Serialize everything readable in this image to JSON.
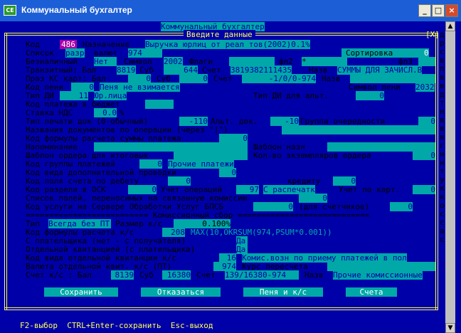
{
  "window": {
    "title": "Коммунальный бухгалтер",
    "icon_text": "CE",
    "min": "_",
    "max": "□",
    "close": "×"
  },
  "console": {
    "header": "Коммунальный бухгалтер",
    "dialog_title": "Введите данные",
    "close_marker": "[X]",
    "right": [
      "д",
      "р",
      "с",
      "в",
      "п",
      "в",
      "в",
      "д",
      "т",
      "н",
      "в",
      "в",
      "в",
      "г",
      "н",
      "н",
      "т",
      "у",
      "к",
      "к",
      "о",
      "с",
      "с",
      "а",
      "с"
    ]
  },
  "f": {
    "kod_l": "Код",
    "kod_v": "486",
    "nazn_l": "Назначение",
    "nazn_v": "Выручка юрлиц от реал тов(2002)0.1%",
    "spisok_l": "Список",
    "spisok_v": "разр",
    "valyut_l": "валют",
    "valyut_v": "974",
    "sort_l": "Сортировка",
    "sort_v": "0",
    "bezn_l": "Безналичный",
    "bezn_v": "Нет",
    "simv_l": "Символ",
    "simv_v": "2002",
    "flagi_l": "Флаги",
    "fl2_l": "фл2",
    "fl2_v": "*",
    "fl3_l": "фл3",
    "tranz_l": "Транзитный: Бал",
    "tranz_bal": "8819",
    "tranz_sub_l": "Суб",
    "tranz_sub": "644",
    "tranz_sch_l": "Счет",
    "tranz_sch": "3819382111435",
    "tranz_naz_l": "Назв",
    "tranz_naz": "СУММЫ ДЛЯ ЗАЧИСЛ.В",
    "ks_l": "Праз КС карт: Бал",
    "ks_bal": "0",
    "ks_sub_l": "Суб",
    "ks_sub": "0",
    "ks_sch_l": "Счет",
    "ks_sch": "-1/0/0-974",
    "ks_naz_l": "Назв",
    "peni_l": "Код пени",
    "peni_v": "0",
    "peni_t": "Пеня не взимается",
    "speni_l": "Символ пени",
    "speni_v": "2032",
    "tdi_l": "Тип ДИ",
    "tdi_v": "11",
    "tdi_t": "Юр.лица",
    "tdia_l": "Тип ДИ для альт.",
    "tdia_v": "0",
    "bud_l": "Код платежа в бюджет",
    "nds_l": "Ставка НДС",
    "nds_v": "0.0",
    "nds_p": "%",
    "tpech_l": "Тип печати док (0-обычный)",
    "tpech_v": "-110",
    "alt_l": "Альт. док.",
    "alt_v": "-10",
    "grup_l": "Группа очередности",
    "grup_v": "0",
    "ndok_l": "Названия документов по операции (через \"|\")",
    "kform_l": "Код формулы расчета суммы платежа",
    "kform_v": "0",
    "napom_l": "Напоминание",
    "shn_l": "Шаблон назн",
    "sho_l": "Шаблон ордера для итоговых",
    "kolvo_l": "Кол-во экземпляров ордера",
    "kolvo_v": "0",
    "kgr_l": "Код группы платежей",
    "kgr_v": "0",
    "kgr_t": "Прочие платежи",
    "kvid_l": "Код вида дополнительной проводки",
    "kvid_v": "0",
    "kpol_l": "Код поля счета по дебету",
    "kpol_v": "0",
    "kred_l": "кредиту",
    "kred_v": "0",
    "razd_l": "Код раздела в ОСК",
    "razd_v": "0",
    "uch_l": "Учет операций",
    "uch_v": "97",
    "uch_t": "С распечатк",
    "uchk_l": "Учет по карт.",
    "uchk_v": "0",
    "spol_l": "Список полей, переносимых на связанную комиссию",
    "spol_v": "0",
    "usl_l": "Код услуги на Сервере Обработки Услуг БПСБ",
    "usl_v": "0",
    "usl_t": "(для счетчиков)",
    "usl_v2": "0",
    "sep": "========================== Комиссионный сбор ============================",
    "tip_l": "Тип",
    "tip_v": "Всегда без ПТ",
    "razm_l": "Размер к/с",
    "razm_v": "0.100%",
    "kfr_l": "Код формулы расчета к/с",
    "kfr_v": "208",
    "kfr_t": "MAX(10,OKRSUM(974,PSUM*0.001))",
    "splat_l": "С плательщика (нет - с получателя)",
    "splat_v": "Да",
    "otd_l": "Отдельной квитанцией (с плательщика)",
    "otd_v": "Да",
    "kvot_l": "Код вида отдельной квитанции к/с",
    "kvot_v": "16",
    "kvot_t": "Комис.возн по приему платежей в пол",
    "valot_l": "Валюта отдельной квит. к/с (ПТ)",
    "valot_v": "974",
    "kurs_l": "Курс пересчета",
    "sks_l": "Счет к/с : Бал",
    "sks_bal": "8139",
    "sks_sub_l": "Суб",
    "sks_sub": "16380",
    "sks_sch_l": "Счет",
    "sks_sch": "139/16380-974",
    "sks_naz_l": "Назв",
    "sks_naz": "Прочие комиссионные"
  },
  "buttons": {
    "save": "Сохранить",
    "cancel": "Отказаться",
    "peni": "Пеня и к/с",
    "accounts": "Счета"
  },
  "footer": "F2-выбор  CTRL+Enter-сохранить  Esc-выход"
}
